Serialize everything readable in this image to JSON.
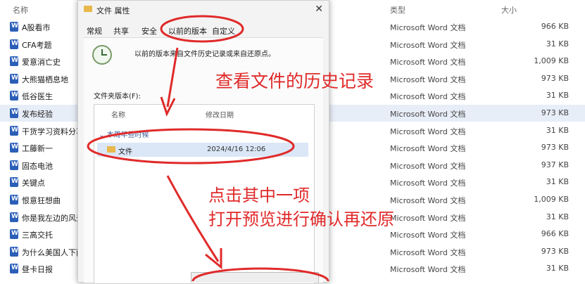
{
  "explorer": {
    "col_name": "名称",
    "col_type": "类型",
    "col_size": "大小",
    "rows": [
      {
        "name": "A股看市",
        "type": "Microsoft Word 文档",
        "size": "966 KB"
      },
      {
        "name": "CFA考题",
        "type": "Microsoft Word 文档",
        "size": "31 KB"
      },
      {
        "name": "爱意消亡史",
        "type": "Microsoft Word 文档",
        "size": "1,009 KB"
      },
      {
        "name": "大熊猫栖息地",
        "type": "Microsoft Word 文档",
        "size": "973 KB"
      },
      {
        "name": "低谷医生",
        "type": "Microsoft Word 文档",
        "size": "31 KB"
      },
      {
        "name": "发布经验",
        "type": "Microsoft Word 文档",
        "size": "973 KB"
      },
      {
        "name": "干货学习资料分享",
        "type": "Microsoft Word 文档",
        "size": "31 KB"
      },
      {
        "name": "工藤新一",
        "type": "Microsoft Word 文档",
        "size": "973 KB"
      },
      {
        "name": "固态电池",
        "type": "Microsoft Word 文档",
        "size": "937 KB"
      },
      {
        "name": "关键点",
        "type": "Microsoft Word 文档",
        "size": "31 KB"
      },
      {
        "name": "恨意狂想曲",
        "type": "Microsoft Word 文档",
        "size": "1,009 KB"
      },
      {
        "name": "你是我左边的风景",
        "type": "Microsoft Word 文档",
        "size": "31 KB"
      },
      {
        "name": "三高交托",
        "type": "Microsoft Word 文档",
        "size": "966 KB"
      },
      {
        "name": "为什么美国人下雨",
        "type": "Microsoft Word 文档",
        "size": "973 KB"
      },
      {
        "name": "昼卡日报",
        "type": "Microsoft Word 文档",
        "size": "31 KB"
      }
    ],
    "selected_index": 5
  },
  "dialog": {
    "title": "文件 属性",
    "close": "✕",
    "tabs": [
      "常规",
      "共享",
      "安全",
      "以前的版本",
      "自定义"
    ],
    "active_tab": 3,
    "info": "以前的版本来自文件历史记录或来自还原点。",
    "versions_label": "文件夹版本(F):",
    "list_col_name": "名称",
    "list_col_date": "修改日期",
    "group": "本周早些时候",
    "item_name": "文件",
    "item_date": "2024/4/16 12:06"
  },
  "annotations": {
    "a1": "查看文件的历史记录",
    "a2": "点击其中一项",
    "a3": "打开预览进行确认再还原",
    "color": "#e02a2a"
  }
}
